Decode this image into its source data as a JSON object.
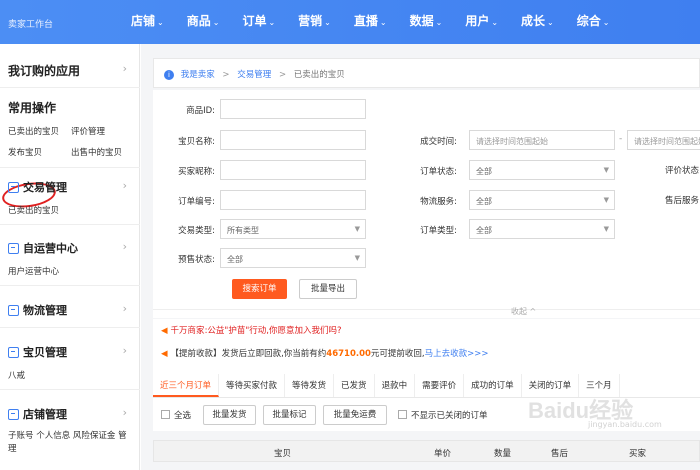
{
  "header": {
    "brand": "卖家工作台",
    "nav": [
      "店铺",
      "商品",
      "订单",
      "营销",
      "直播",
      "数据",
      "用户",
      "成长",
      "综合"
    ],
    "caret": "⌄"
  },
  "sidebar": {
    "my_apps": "我订购的应用",
    "common_ops": "常用操作",
    "links": [
      "已卖出的宝贝",
      "评价管理",
      "发布宝贝",
      "出售中的宝贝"
    ],
    "sections": [
      {
        "title": "交易管理",
        "sub": "已卖出的宝贝"
      },
      {
        "title": "自运营中心",
        "sub": "用户运营中心"
      },
      {
        "title": "物流管理",
        "sub": ""
      },
      {
        "title": "宝贝管理",
        "sub": "八戒"
      },
      {
        "title": "店铺管理",
        "sub": "子账号 个人信息 风险保证金 管理"
      }
    ],
    "chevron": "›"
  },
  "breadcrumb": {
    "items": [
      "我是卖家",
      "交易管理",
      "已卖出的宝贝"
    ],
    "sep": ">"
  },
  "form": {
    "labels": {
      "product_id": "商品ID:",
      "item_name": "宝贝名称:",
      "buyer_nick": "买家昵称:",
      "order_no": "订单编号:",
      "trade_type": "交易类型:",
      "presale_status": "预售状态:",
      "deal_time": "成交时间:",
      "order_status": "订单状态:",
      "logistics": "物流服务:",
      "order_type": "订单类型:",
      "review_status": "评价状态",
      "after_sale": "售后服务"
    },
    "values": {
      "trade_type": "所有类型",
      "presale_status": "全部",
      "order_status": "全部",
      "logistics": "全部",
      "order_type": "全部",
      "date_start": "请选择时间范围起始",
      "date_end": "请选择时间范围起始",
      "date_sep": "-"
    },
    "search_button": "搜索订单",
    "export_button": "批量导出",
    "collapse": "收起 ^"
  },
  "notices": {
    "n1_prefix": "千万商家",
    "n1_text": ":公益\"护苗\"行动,你愿意加入我们吗?",
    "n2_tag": "【提前收款】",
    "n2_text": "发货后立即回款,你当前有约",
    "n2_amount": "46710.00",
    "n2_text2": "元可提前收回,",
    "n2_link": "马上去收款>>>"
  },
  "tabs": [
    "近三个月订单",
    "等待买家付款",
    "等待发货",
    "已发货",
    "退款中",
    "需要评价",
    "成功的订单",
    "关闭的订单",
    "三个月"
  ],
  "actions": {
    "select_all": "全选",
    "batch_ship": "批量发货",
    "batch_mark": "批量标记",
    "batch_free": "批量免运费",
    "hide_closed": "不显示已关闭的订单"
  },
  "table_head": [
    "宝贝",
    "单价",
    "数量",
    "售后",
    "买家"
  ],
  "watermark": {
    "main": "Baidu经验",
    "sub": "jingyan.baidu.com"
  },
  "colors": {
    "nav_bg": "#4c8ef4",
    "primary": "#ff5a1f",
    "link": "#3f7ff0",
    "annotation": "#e02020"
  }
}
